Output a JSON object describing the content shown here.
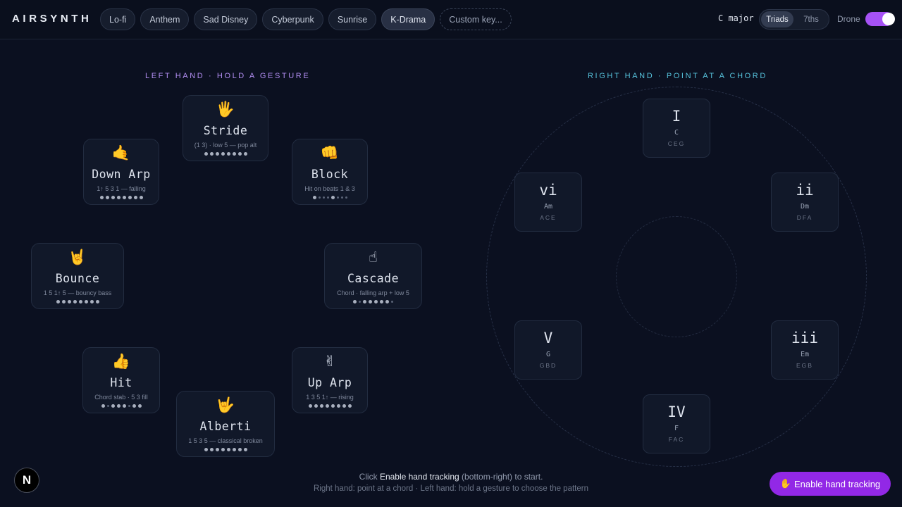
{
  "brand": "AIRSYNTH",
  "presets": [
    {
      "label": "Lo-fi",
      "active": false
    },
    {
      "label": "Anthem",
      "active": false
    },
    {
      "label": "Sad Disney",
      "active": false
    },
    {
      "label": "Cyberpunk",
      "active": false
    },
    {
      "label": "Sunrise",
      "active": false
    },
    {
      "label": "K-Drama",
      "active": true
    }
  ],
  "custom_key": "Custom key...",
  "key_label": "C major",
  "voicing": {
    "triads": "Triads",
    "sevenths": "7ths",
    "selected": "Triads"
  },
  "drone": {
    "label": "Drone",
    "on": true
  },
  "left_heading": "LEFT HAND · HOLD A GESTURE",
  "right_heading": "RIGHT HAND · POINT AT A CHORD",
  "gestures": [
    {
      "emoji": "🖐",
      "name": "Stride",
      "desc": "(1 3) · low 5 — pop alt"
    },
    {
      "emoji": "🤙",
      "name": "Down Arp",
      "desc": "1↑ 5 3 1 — falling"
    },
    {
      "emoji": "👊",
      "name": "Block",
      "desc": "Hit on beats 1 & 3"
    },
    {
      "emoji": "🤘",
      "name": "Bounce",
      "desc": "1 5 1↑ 5 — bouncy bass"
    },
    {
      "emoji": "☝",
      "name": "Cascade",
      "desc": "Chord · falling arp + low 5"
    },
    {
      "emoji": "👍",
      "name": "Hit",
      "desc": "Chord stab · 5 3 fill"
    },
    {
      "emoji": "✌",
      "name": "Up Arp",
      "desc": "1 3 5 1↑ — rising"
    },
    {
      "emoji": "🤟",
      "name": "Alberti",
      "desc": "1 5 3 5 — classical broken"
    }
  ],
  "chords": [
    {
      "roman": "I",
      "name": "C",
      "notes": "CEG"
    },
    {
      "roman": "ii",
      "name": "Dm",
      "notes": "DFA"
    },
    {
      "roman": "iii",
      "name": "Em",
      "notes": "EGB"
    },
    {
      "roman": "IV",
      "name": "F",
      "notes": "FAC"
    },
    {
      "roman": "V",
      "name": "G",
      "notes": "GBD"
    },
    {
      "roman": "vi",
      "name": "Am",
      "notes": "ACE"
    }
  ],
  "footer": {
    "hint_prefix": "Click",
    "hint_bold": "Enable hand tracking",
    "hint_suffix": "(bottom-right) to start.",
    "hint_line2": "Right hand: point at a chord · Left hand: hold a gesture to choose the pattern",
    "enable_icon": "✋",
    "enable_label": "Enable hand tracking",
    "logo_letter": "N"
  }
}
